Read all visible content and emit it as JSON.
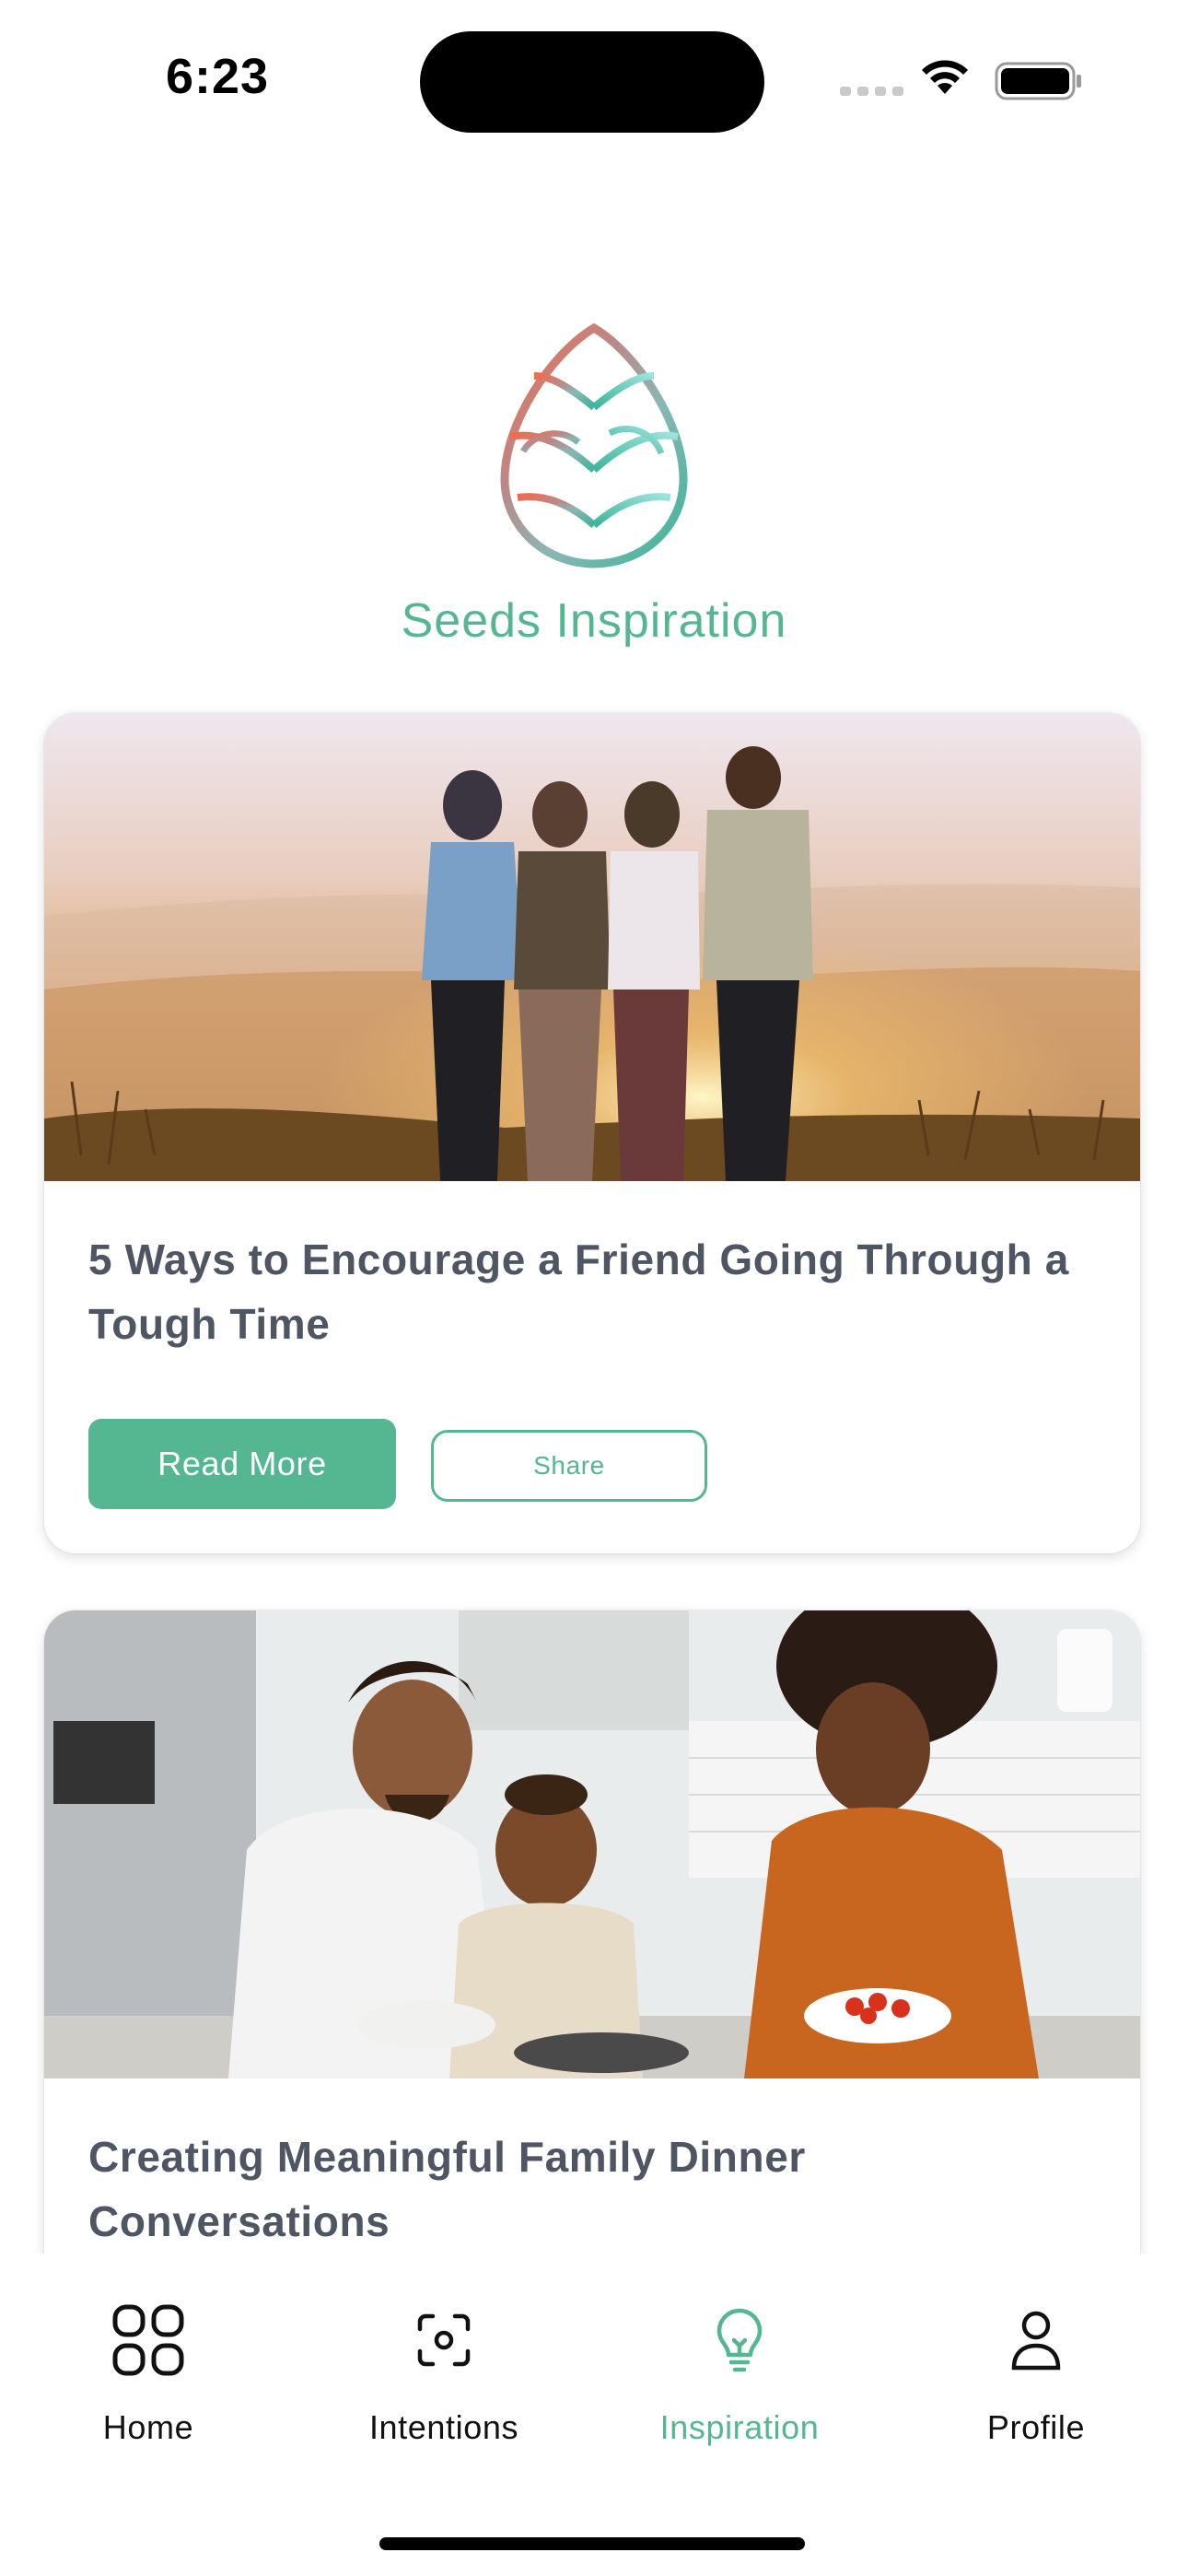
{
  "status_bar": {
    "time": "6:23"
  },
  "header": {
    "title": "Seeds Inspiration"
  },
  "articles": [
    {
      "title": "5 Ways to Encourage a Friend Going Through a Tough Time",
      "read_more_label": "Read More",
      "share_label": "Share"
    },
    {
      "title": "Creating Meaningful Family Dinner Conversations"
    }
  ],
  "tab_bar": {
    "items": [
      {
        "label": "Home",
        "icon": "grid-icon"
      },
      {
        "label": "Intentions",
        "icon": "focus-icon"
      },
      {
        "label": "Inspiration",
        "icon": "lightbulb-icon",
        "active": true
      },
      {
        "label": "Profile",
        "icon": "person-icon"
      }
    ]
  },
  "colors": {
    "accent": "#55b692",
    "text": "#4e5563"
  }
}
